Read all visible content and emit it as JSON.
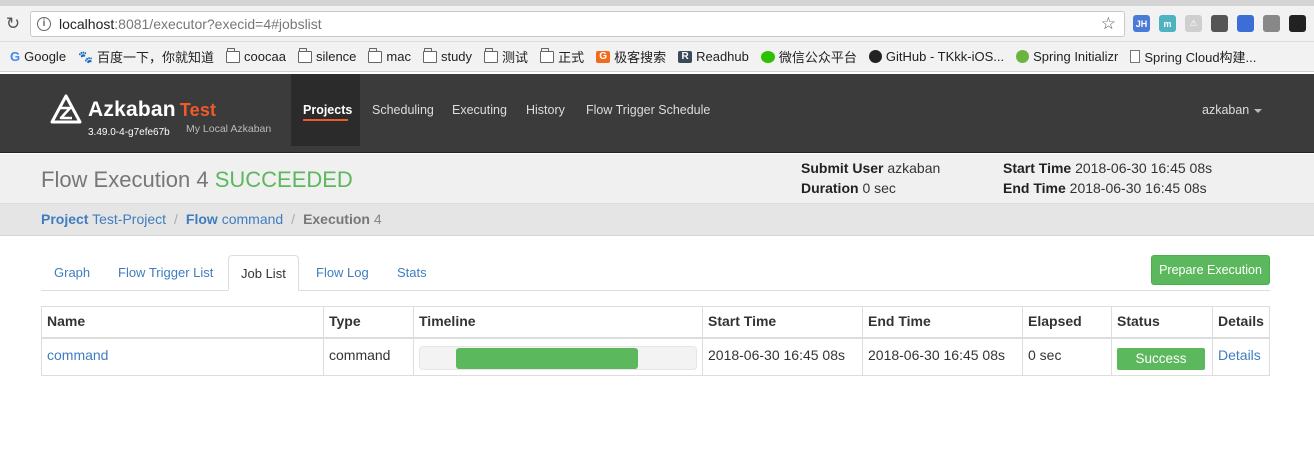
{
  "browser": {
    "url_host": "localhost",
    "url_rest": ":8081/executor?execid=4#jobslist",
    "bookmarks": [
      {
        "label": "Google",
        "icon": "google-icon"
      },
      {
        "label": "百度一下，你就知道",
        "icon": "baidu-icon"
      },
      {
        "label": "coocaa",
        "icon": "folder-icon"
      },
      {
        "label": "silence",
        "icon": "folder-icon"
      },
      {
        "label": "mac",
        "icon": "folder-icon"
      },
      {
        "label": "study",
        "icon": "folder-icon"
      },
      {
        "label": "测试",
        "icon": "folder-icon"
      },
      {
        "label": "正式",
        "icon": "folder-icon"
      },
      {
        "label": "极客搜索",
        "icon": "geek-search-icon"
      },
      {
        "label": "Readhub",
        "icon": "readhub-icon"
      },
      {
        "label": "微信公众平台",
        "icon": "wechat-icon"
      },
      {
        "label": "GitHub - TKkk-iOS...",
        "icon": "github-icon"
      },
      {
        "label": "Spring Initializr",
        "icon": "spring-icon"
      },
      {
        "label": "Spring Cloud构建...",
        "icon": "page-icon"
      }
    ],
    "extensions": [
      {
        "text": "JH",
        "color": "#4a7bd6"
      },
      {
        "text": "m",
        "color": "#4fb3bf"
      },
      {
        "text": "⚠",
        "color": "#cfcfcf"
      },
      {
        "text": "",
        "color": "#555555"
      },
      {
        "text": "",
        "color": "#3b6fd6"
      },
      {
        "text": "",
        "color": "#888888"
      },
      {
        "text": "",
        "color": "#222222"
      }
    ]
  },
  "nav": {
    "brand": "Azkaban",
    "env": "Test",
    "version": "3.49.0-4-g7efe67b",
    "subtitle": "My Local Azkaban",
    "items": [
      "Projects",
      "Scheduling",
      "Executing",
      "History",
      "Flow Trigger Schedule"
    ],
    "user": "azkaban"
  },
  "header": {
    "title_prefix": "Flow Execution",
    "exec_id": "4",
    "status": "SUCCEEDED",
    "submit_user_label": "Submit User",
    "submit_user": "azkaban",
    "duration_label": "Duration",
    "duration": "0 sec",
    "start_time_label": "Start Time",
    "start_time": "2018-06-30 16:45 08s",
    "end_time_label": "End Time",
    "end_time": "2018-06-30 16:45 08s"
  },
  "breadcrumb": {
    "project_label": "Project",
    "project": "Test-Project",
    "flow_label": "Flow",
    "flow": "command",
    "execution_label": "Execution",
    "execution": "4"
  },
  "tabs": [
    "Graph",
    "Flow Trigger List",
    "Job List",
    "Flow Log",
    "Stats"
  ],
  "prepare_button": "Prepare Execution",
  "table": {
    "headers": [
      "Name",
      "Type",
      "Timeline",
      "Start Time",
      "End Time",
      "Elapsed",
      "Status",
      "Details"
    ],
    "rows": [
      {
        "name": "command",
        "type": "command",
        "timeline_start": 0.13,
        "timeline_end": 0.79,
        "start_time": "2018-06-30 16:45 08s",
        "end_time": "2018-06-30 16:45 08s",
        "elapsed": "0 sec",
        "status": "Success",
        "details": "Details"
      }
    ]
  },
  "colors": {
    "success": "#5cb85c",
    "accent": "#ef5a2a",
    "link": "#3f7dc0"
  }
}
